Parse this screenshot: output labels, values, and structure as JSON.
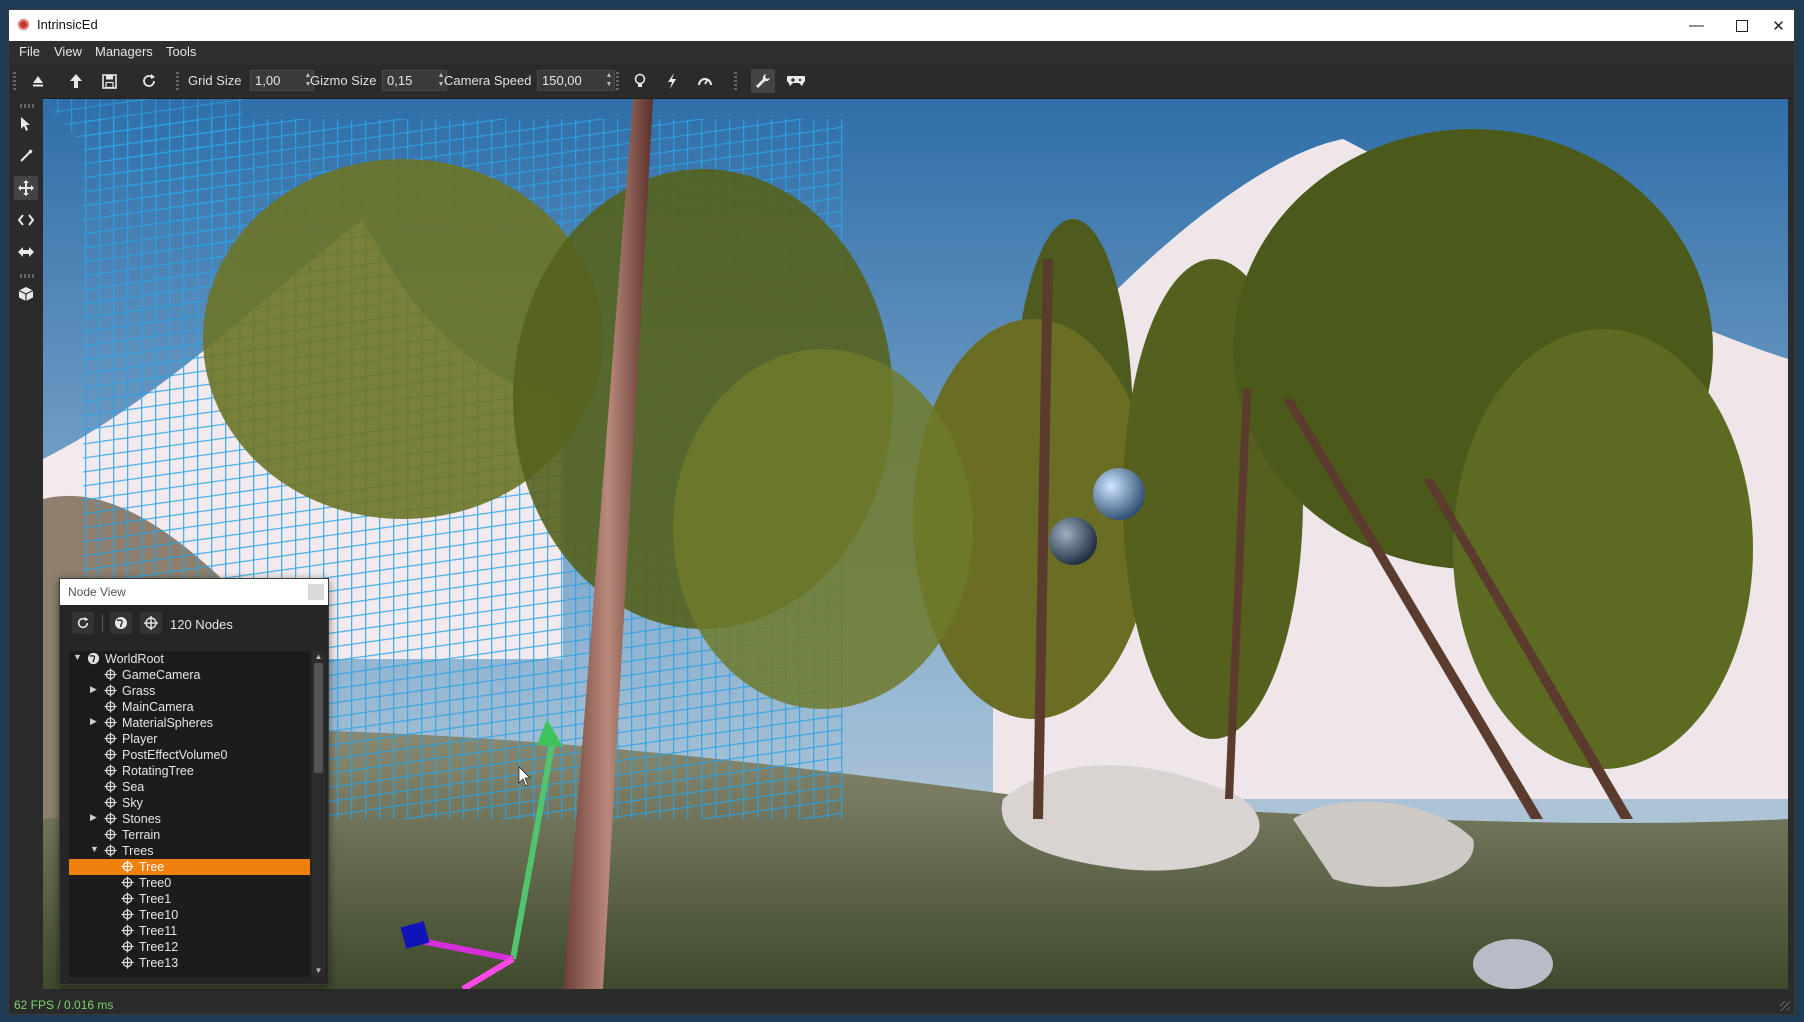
{
  "window": {
    "title": "IntrinsicEd",
    "minimize_icon": "minimize-icon",
    "maximize_icon": "maximize-icon",
    "close_icon": "close-icon"
  },
  "menu": [
    "File",
    "View",
    "Managers",
    "Tools"
  ],
  "toolbar": {
    "grid_size_label": "Grid Size",
    "grid_size_value": "1,00",
    "gizmo_size_label": "Gizmo Size",
    "gizmo_size_value": "0,15",
    "camera_speed_label": "Camera Speed",
    "camera_speed_value": "150,00"
  },
  "node_view": {
    "title": "Node View",
    "count": "120 Nodes",
    "items": [
      {
        "label": "WorldRoot",
        "depth": 0,
        "expanded": true,
        "icon": "globe-icon"
      },
      {
        "label": "GameCamera",
        "depth": 1,
        "icon": "node-icon"
      },
      {
        "label": "Grass",
        "depth": 1,
        "collapsed": true,
        "icon": "node-icon"
      },
      {
        "label": "MainCamera",
        "depth": 1,
        "icon": "node-icon"
      },
      {
        "label": "MaterialSpheres",
        "depth": 1,
        "collapsed": true,
        "icon": "node-icon"
      },
      {
        "label": "Player",
        "depth": 1,
        "icon": "node-icon"
      },
      {
        "label": "PostEffectVolume0",
        "depth": 1,
        "icon": "node-icon"
      },
      {
        "label": "RotatingTree",
        "depth": 1,
        "icon": "node-icon"
      },
      {
        "label": "Sea",
        "depth": 1,
        "icon": "node-icon"
      },
      {
        "label": "Sky",
        "depth": 1,
        "icon": "node-icon"
      },
      {
        "label": "Stones",
        "depth": 1,
        "collapsed": true,
        "icon": "node-icon"
      },
      {
        "label": "Terrain",
        "depth": 1,
        "icon": "node-icon"
      },
      {
        "label": "Trees",
        "depth": 1,
        "expanded": true,
        "icon": "node-icon"
      },
      {
        "label": "Tree",
        "depth": 2,
        "selected": true,
        "icon": "node-icon"
      },
      {
        "label": "Tree0",
        "depth": 2,
        "icon": "node-icon"
      },
      {
        "label": "Tree1",
        "depth": 2,
        "icon": "node-icon"
      },
      {
        "label": "Tree10",
        "depth": 2,
        "icon": "node-icon"
      },
      {
        "label": "Tree11",
        "depth": 2,
        "icon": "node-icon"
      },
      {
        "label": "Tree12",
        "depth": 2,
        "icon": "node-icon"
      },
      {
        "label": "Tree13",
        "depth": 2,
        "icon": "node-icon"
      }
    ]
  },
  "status": {
    "fps": "62 FPS / 0.016 ms"
  },
  "colors": {
    "selection": "#f0800c",
    "fps_text": "#7bd46a",
    "grid": "#2aa3e6"
  }
}
